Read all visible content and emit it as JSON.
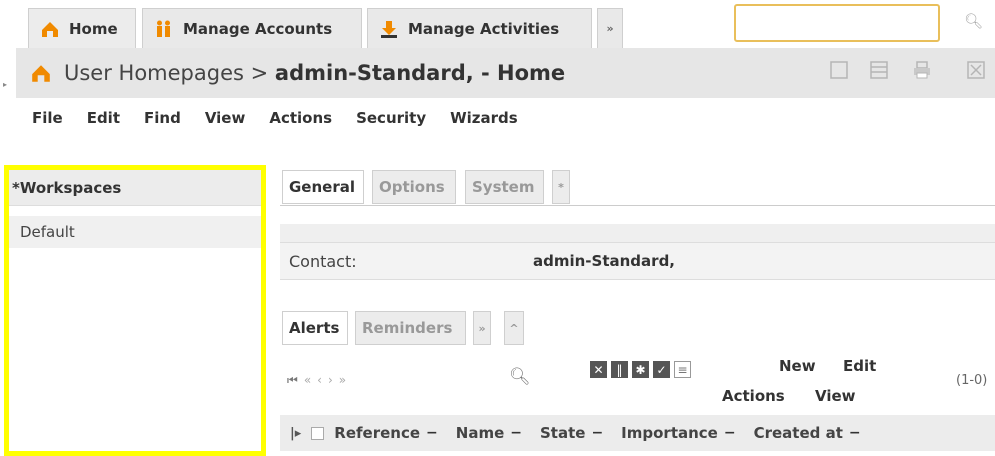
{
  "top_tabs": [
    {
      "label": "Home",
      "icon": "home-icon"
    },
    {
      "label": "Manage Accounts",
      "icon": "users-icon"
    },
    {
      "label": "Manage Activities",
      "icon": "download-icon"
    },
    {
      "label": "»",
      "icon": ""
    }
  ],
  "search": {
    "placeholder": ""
  },
  "title": {
    "prefix": "User Homepages >",
    "bold": "admin-Standard, - Home"
  },
  "menu": [
    "File",
    "Edit",
    "Find",
    "View",
    "Actions",
    "Security",
    "Wizards"
  ],
  "workspaces": {
    "header": "*Workspaces",
    "items": [
      "Default"
    ]
  },
  "upper_tabs": [
    "General",
    "Options",
    "System",
    "*"
  ],
  "contact": {
    "label": "Contact:",
    "value": "admin-Standard,"
  },
  "lower_tabs": [
    "Alerts",
    "Reminders",
    "»",
    "^"
  ],
  "toolbar": {
    "new": "New",
    "edit": "Edit",
    "actions": "Actions",
    "view": "View",
    "count": "(1-0)"
  },
  "columns": [
    "Reference",
    "Name",
    "State",
    "Importance",
    "Created at"
  ],
  "colors": {
    "highlight": "#ffff00",
    "search_border": "#e9bf5b",
    "home_icon": "#f08a00"
  }
}
